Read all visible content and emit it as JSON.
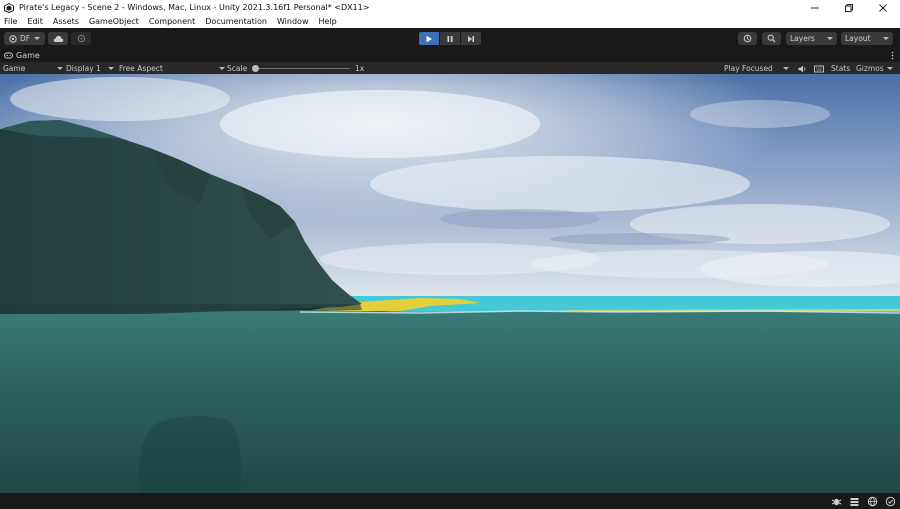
{
  "window": {
    "title": "Pirate's Legacy - Scene 2 - Windows, Mac, Linux - Unity 2021.3.16f1 Personal* <DX11>"
  },
  "menu": {
    "items": [
      "File",
      "Edit",
      "Assets",
      "GameObject",
      "Component",
      "Documentation",
      "Window",
      "Help"
    ]
  },
  "toolbar": {
    "account_label": "DF",
    "layers_label": "Layers",
    "layout_label": "Layout"
  },
  "tab": {
    "label": "Game"
  },
  "game_view": {
    "mode": "Game",
    "display": "Display 1",
    "aspect": "Free Aspect",
    "scale_label": "Scale",
    "scale_value": "1x",
    "scale_fraction": 0.0,
    "play_mode": "Play Focused",
    "stats_label": "Stats",
    "gizmos_label": "Gizmos"
  },
  "colors": {
    "play_active": "#3b6fb6",
    "sea": "#2f6863",
    "lagoon": "#45c9d6",
    "sand": "#e4cf3a",
    "cliff": "#2b4a49"
  }
}
